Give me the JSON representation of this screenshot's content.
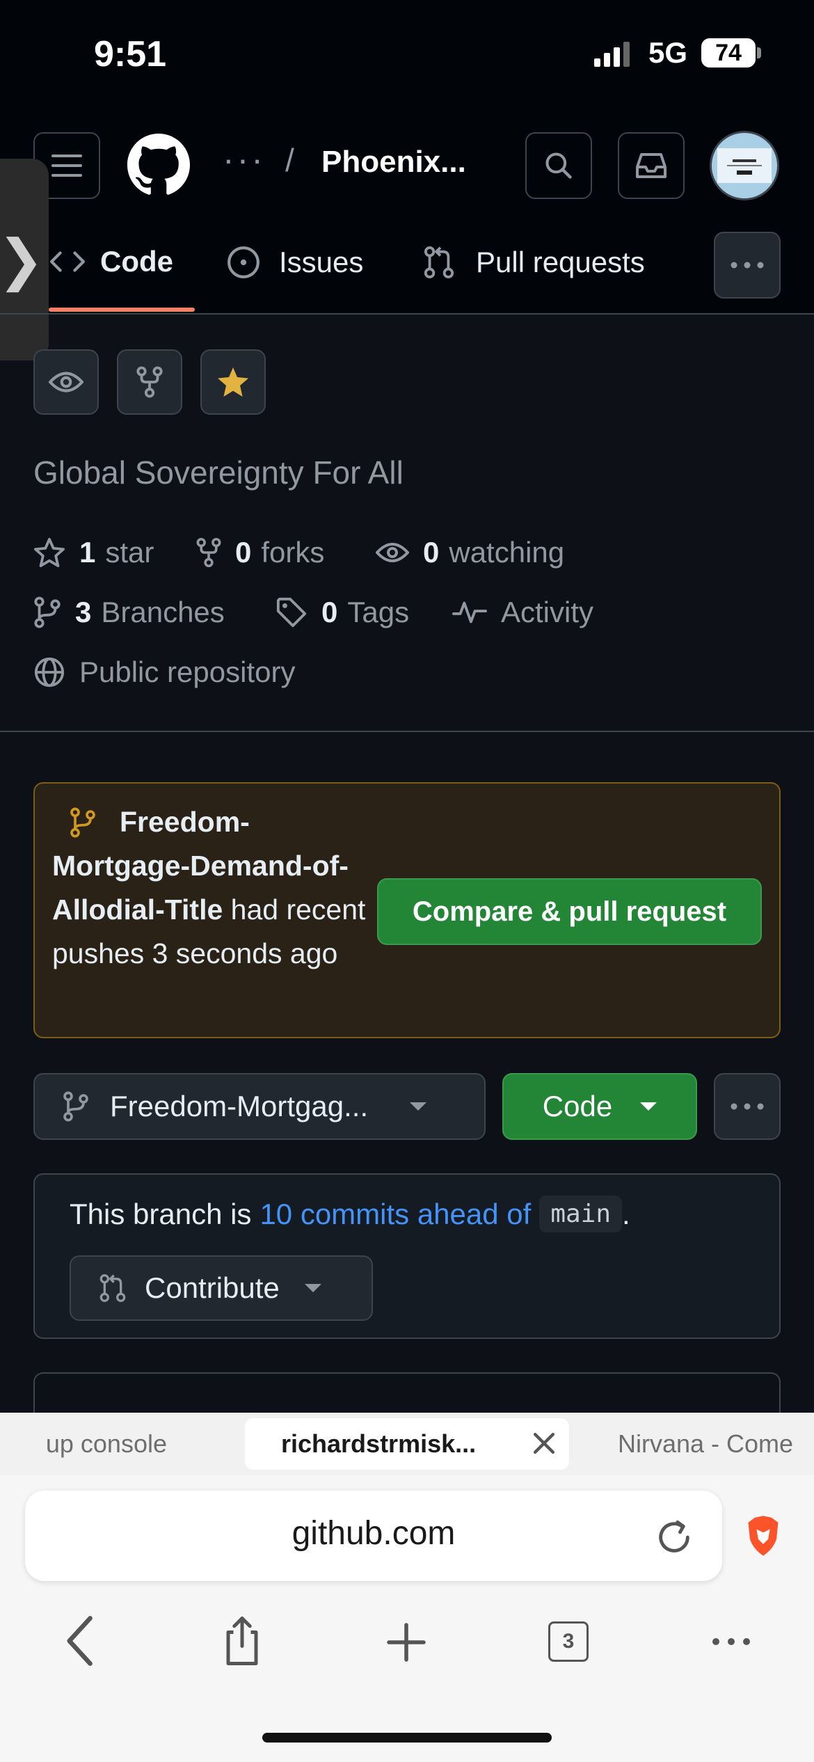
{
  "status_bar": {
    "time": "9:51",
    "network": "5G",
    "battery": "74"
  },
  "header": {
    "ellipsis": "···",
    "separator": "/",
    "repo_name": "Phoenix..."
  },
  "tabs": [
    {
      "label": "Code",
      "icon": "code-icon",
      "active": true
    },
    {
      "label": "Issues",
      "icon": "issue-opened-icon"
    },
    {
      "label": "Pull requests",
      "icon": "git-pull-request-icon"
    }
  ],
  "side_tab_glyph": "❯",
  "repo": {
    "description": "Global Sovereignty For All",
    "stars_count": "1",
    "stars_label": "star",
    "forks_count": "0",
    "forks_label": "forks",
    "watching_count": "0",
    "watching_label": "watching",
    "branches_count": "3",
    "branches_label": "Branches",
    "tags_count": "0",
    "tags_label": "Tags",
    "activity_label": "Activity",
    "visibility": "Public repository"
  },
  "push_banner": {
    "branch": "Freedom-Mortgage-Demand-of-Allodial-Title",
    "message": "had recent pushes 3 seconds ago",
    "button": "Compare & pull request"
  },
  "branch_bar": {
    "branch": "Freedom-Mortgag...",
    "code_button": "Code"
  },
  "ahead": {
    "prefix": "This branch is",
    "link": "10 commits ahead of",
    "base": "main",
    "suffix": ".",
    "contribute": "Contribute"
  },
  "browser": {
    "tab_left": "up console",
    "tab_active": "richardstrmisk...",
    "tab_right": "Nirvana - Come",
    "url": "github.com",
    "tab_count": "3"
  },
  "colors": {
    "accent_green": "#238636",
    "link_blue": "#4493f8",
    "tab_underline": "#f78166",
    "star": "#e3b341"
  }
}
